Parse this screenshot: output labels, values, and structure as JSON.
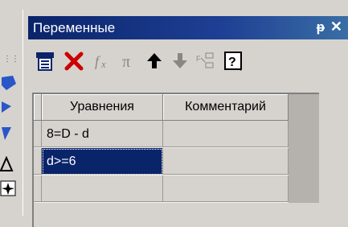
{
  "panel": {
    "title": "Переменные",
    "pin_icon": "pin-icon",
    "close_label": "✕"
  },
  "toolbar": {
    "icons": [
      "insert-variable-icon",
      "delete-icon",
      "function-icon",
      "pi-icon",
      "move-up-icon",
      "move-down-icon",
      "insert-fragment-icon",
      "help-icon"
    ]
  },
  "table": {
    "headers": [
      "Уравнения",
      "Комментарий"
    ],
    "rows": [
      {
        "equation": "8=D - d",
        "comment": ""
      },
      {
        "equation": "d>=6",
        "comment": "",
        "selected": true
      },
      {
        "equation": "",
        "comment": ""
      }
    ]
  },
  "colors": {
    "title_bar": "#0a246a",
    "selection": "#0a246a",
    "face": "#d6d3ce",
    "delete_red": "#cc0000"
  }
}
